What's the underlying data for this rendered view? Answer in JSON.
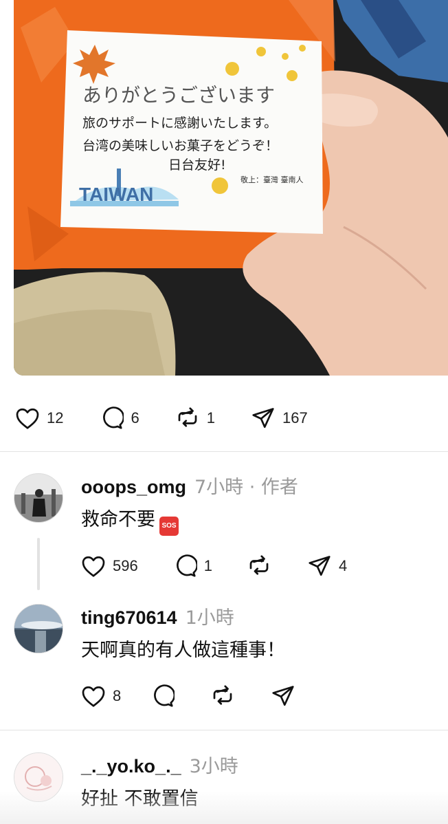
{
  "post": {
    "image": {
      "card_lines": [
        "ありがとうございます",
        "旅のサポートに感謝いたします。",
        "台湾の美味しいお菓子をどうぞ！",
        "日台友好!"
      ],
      "card_sign": "敬上：臺灣 臺南人",
      "card_logo": "TAIWAN"
    },
    "actions": {
      "like_count": "12",
      "comment_count": "6",
      "repost_count": "1",
      "share_count": "167"
    }
  },
  "comments": [
    {
      "username": "ooops_omg",
      "meta": "7小時 · 作者",
      "text": "救命不要",
      "badge": "SOS",
      "actions": {
        "like_count": "596",
        "comment_count": "1",
        "repost_count": "",
        "share_count": "4"
      }
    },
    {
      "username": "ting670614",
      "meta": "1小時",
      "text": "天啊真的有人做這種事！",
      "actions": {
        "like_count": "8",
        "comment_count": "",
        "repost_count": "",
        "share_count": ""
      }
    },
    {
      "username": "_._yo.ko_._",
      "meta": "3小時",
      "text": "好扯 不敢置信"
    }
  ],
  "icons": {
    "like": "heart-icon",
    "comment": "comment-bubble-icon",
    "repost": "repost-icon",
    "share": "send-icon"
  },
  "colors": {
    "bag_orange": "#ee6a1d",
    "text_primary": "#111111",
    "text_secondary": "#9a9a9a",
    "divider": "#e3e3e3",
    "sos_red": "#e53935"
  }
}
